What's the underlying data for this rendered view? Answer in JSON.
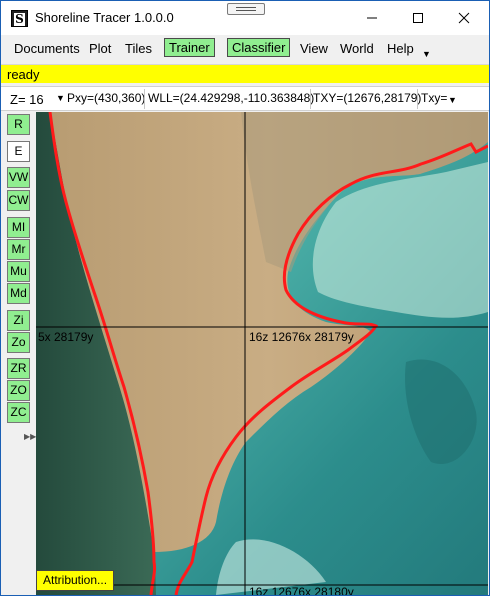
{
  "window": {
    "title": "Shoreline Tracer 1.0.0.0"
  },
  "menu": {
    "documents": "Documents",
    "plot": "Plot",
    "tiles": "Tiles",
    "trainer": "Trainer",
    "classifier": "Classifier",
    "view": "View",
    "world": "World",
    "help": "Help"
  },
  "status": {
    "text": "ready"
  },
  "coords": {
    "zoom": "Z= 16",
    "pxy": "Pxy=(430,360)",
    "wll": "WLL=(24.429298,-110.363848)",
    "txy": "TXY=(12676,28179)",
    "txy_short": "Txy="
  },
  "toolbar": {
    "r": "R",
    "e": "E",
    "vw": "VW",
    "cw": "CW",
    "mi": "MI",
    "mr": "Mr",
    "mu": "Mu",
    "md": "Md",
    "zi": "Zi",
    "zo": "Zo",
    "zr": "ZR",
    "zo2": "ZO",
    "zc": "ZC"
  },
  "map": {
    "tile_label_left": "5x 28179y",
    "tile_label_center": "16z 12676x 28179y",
    "tile_label_bottom": "16z 12676x 28180y",
    "attribution": "Attribution...",
    "shoreline_color": "#ff1a1a"
  }
}
